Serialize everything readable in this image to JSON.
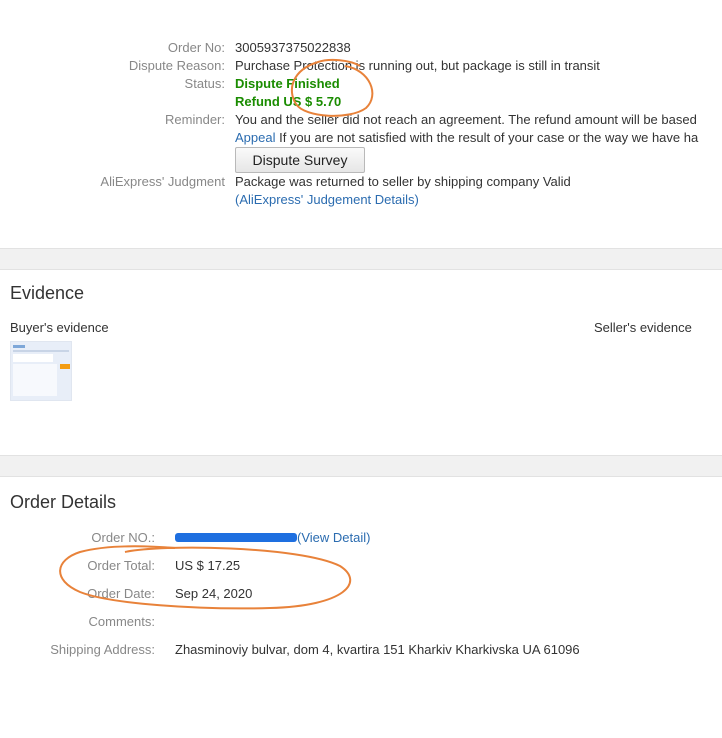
{
  "dispute": {
    "order_no_label": "Order No:",
    "order_no": "3005937375022838",
    "reason_label": "Dispute Reason:",
    "reason": "Purchase Protection is running out, but package is still in transit",
    "status_label": "Status:",
    "status": "Dispute Finished",
    "refund": "Refund US $ 5.70",
    "reminder_label": "Reminder:",
    "reminder": "You and the seller did not reach an agreement. The refund amount will be based",
    "appeal_link": "Appeal",
    "appeal_text": " If you are not satisfied with the result of your case or the way we have ha",
    "survey_button": "Dispute Survey",
    "judgment_label": "AliExpress' Judgment",
    "judgment": "Package was returned to seller by shipping company  Valid",
    "judgment_details_open": "(",
    "judgment_details_link": "AliExpress' Judgement Details",
    "judgment_details_close": ")"
  },
  "evidence": {
    "title": "Evidence",
    "buyer_label": "Buyer's evidence",
    "seller_label": "Seller's evidence"
  },
  "order_details": {
    "title": "Order Details",
    "order_no_label": "Order NO.:",
    "view_detail": "(View Detail)",
    "total_label": "Order Total:",
    "total": "US $ 17.25",
    "date_label": "Order Date:",
    "date": "Sep 24, 2020",
    "comments_label": "Comments:",
    "comments": "",
    "shipping_label": "Shipping Address:",
    "shipping": "Zhasminoviy bulvar, dom 4, kvartira 151 Kharkiv Kharkivska UA 61096"
  },
  "colors": {
    "annotation": "#e8823a",
    "link": "#2b6cb0",
    "status_green": "#1a8c00"
  }
}
